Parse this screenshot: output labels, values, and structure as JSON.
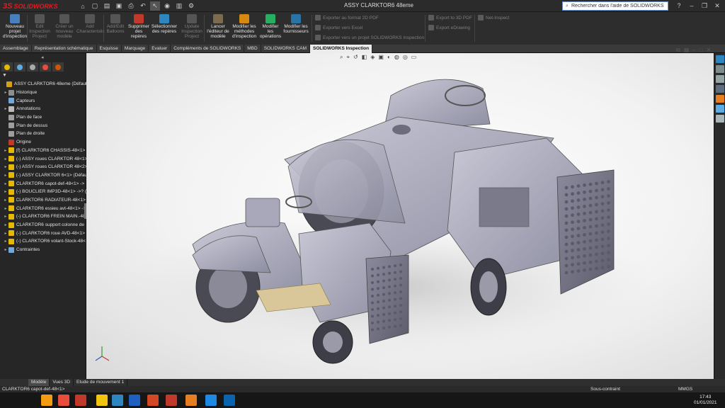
{
  "app": {
    "logo_text": "SOLIDWORKS",
    "logo_glyph": "3S"
  },
  "quick_access": {
    "icons": [
      "home-icon",
      "new-icon",
      "open-icon",
      "save-icon",
      "print-icon",
      "undo-icon",
      "select-icon",
      "rebuild-icon",
      "file-props-icon",
      "options-icon"
    ]
  },
  "title": "ASSY CLARKTOR6 48eme",
  "search": {
    "placeholder": "Rechercher dans l'aide de SOLIDWORKS"
  },
  "ribbon": {
    "buttons": [
      {
        "label": "Nouveau projet d'inspection",
        "enabled": true,
        "color": "#4a7fbf"
      },
      {
        "label": "Edit Inspection Project",
        "enabled": false,
        "color": "#555555"
      },
      {
        "label": "Créer un nouveau modèle",
        "enabled": false,
        "color": "#555555"
      },
      {
        "label": "Add Characteristic",
        "enabled": false,
        "color": "#555555"
      },
      {
        "label": "Add/Edit Balloons",
        "enabled": false,
        "color": "#555555"
      },
      {
        "label": "Supprimer des repères",
        "enabled": true,
        "color": "#c0392b"
      },
      {
        "label": "Sélectionner des repères",
        "enabled": true,
        "color": "#2e86c1"
      },
      {
        "label": "Update Inspection Project",
        "enabled": false,
        "color": "#555555"
      },
      {
        "label": "Lancer l'éditeur de modèle",
        "enabled": true,
        "color": "#7d6b4f"
      },
      {
        "label": "Modifier les méthodes d'inspection",
        "enabled": true,
        "color": "#d68910"
      },
      {
        "label": "Modifier les opérations",
        "enabled": true,
        "color": "#27ae60"
      },
      {
        "label": "Modifier les fournisseurs",
        "enabled": true,
        "color": "#2874a6"
      }
    ],
    "export_group_1": [
      "Exporter au format 2D PDF",
      "Exporter vers Excel",
      "Exporter vers un projet SOLIDWORKS Inspection"
    ],
    "export_group_2": [
      "Export to 3D PDF",
      "Export eDrawing"
    ],
    "export_group_3": [
      "Net-Inspect"
    ]
  },
  "tabs": [
    "Assemblage",
    "Représentation schématique",
    "Esquisse",
    "Marquage",
    "Evaluer",
    "Compléments de SOLIDWORKS",
    "MBD",
    "SOLIDWORKS CAM",
    "SOLIDWORKS Inspection"
  ],
  "active_tab": "SOLIDWORKS Inspection",
  "panel": {
    "tab_icons": [
      "feature-manager-icon",
      "property-manager-icon",
      "configuration-manager-icon",
      "dimxpert-icon",
      "display-manager-icon"
    ],
    "filter_icon": "filter-icon"
  },
  "tree": [
    {
      "label": "ASSY CLARKTOR6 48eme  (Défaut<Eta",
      "icon": "#d4a017",
      "expandable": false
    },
    {
      "label": "Historique",
      "icon": "#8e8e8e",
      "expandable": true
    },
    {
      "label": "Capteurs",
      "icon": "#6fa8dc",
      "expandable": false
    },
    {
      "label": "Annotations",
      "icon": "#bbbbbb",
      "expandable": true
    },
    {
      "label": "Plan de face",
      "icon": "#9e9e9e",
      "expandable": false
    },
    {
      "label": "Plan de dessus",
      "icon": "#9e9e9e",
      "expandable": false
    },
    {
      "label": "Plan de droite",
      "icon": "#9e9e9e",
      "expandable": false
    },
    {
      "label": "Origine",
      "icon": "#c0392b",
      "expandable": false
    },
    {
      "label": "(f) CLARKTOR6 CHASSIS-48<1> ->",
      "icon": "#e6b800",
      "expandable": true
    },
    {
      "label": "(-) ASSY roues CLARKTOR 48<1>",
      "icon": "#e6b800",
      "expandable": true
    },
    {
      "label": "(-) ASSY roues CLARKTOR 48<2>",
      "icon": "#e6b800",
      "expandable": true
    },
    {
      "label": "(-) ASSY CLARKTOR 6<1> (Défaut",
      "icon": "#e6b800",
      "expandable": true
    },
    {
      "label": "CLARKTOR6 capot-def-48<1> ->",
      "icon": "#e6b800",
      "expandable": true
    },
    {
      "label": "(-) BOUCLIER IMP3D-48<1> ->? (I",
      "icon": "#e6b800",
      "expandable": true
    },
    {
      "label": "CLARKTOR6 RADIATEUR-48<1> ->",
      "icon": "#e6b800",
      "expandable": true
    },
    {
      "label": "CLARKTOR6 essieu avt-48<1> ->",
      "icon": "#e6b800",
      "expandable": true
    },
    {
      "label": "(-) CLARKTOR6 FREIN MAIN.-48<",
      "icon": "#e6b800",
      "expandable": true
    },
    {
      "label": "CLARKTOR6 support colonne de",
      "icon": "#e6b800",
      "expandable": true
    },
    {
      "label": "(-) CLARKTOR6 roue AVD-48<1>",
      "icon": "#e6b800",
      "expandable": true
    },
    {
      "label": "(-) CLARKTOR6 volant-Stock-48<",
      "icon": "#e6b800",
      "expandable": true
    },
    {
      "label": "Contraintes",
      "icon": "#6fa8dc",
      "expandable": true
    }
  ],
  "hud_icons": [
    "zoom-fit-icon",
    "zoom-area-icon",
    "previous-view-icon",
    "section-view-icon",
    "view-orientation-icon",
    "display-style-icon",
    "hide-show-icon",
    "appearance-icon",
    "scene-icon",
    "display-settings-icon"
  ],
  "viewport_controls": [
    "restore-icon",
    "tile-icon",
    "minimize-icon",
    "maximize-icon",
    "close-icon"
  ],
  "task_pane_icons": [
    "resources-icon",
    "design-library-icon",
    "file-explorer-icon",
    "view-palette-icon",
    "appearances-icon",
    "custom-props-icon",
    "forum-icon"
  ],
  "bottom_tabs": [
    "Modèle",
    "Vues 3D",
    "Etude de mouvement 1"
  ],
  "status": {
    "selection": "CLARKTOR6 capot-def-48<1>",
    "state": "Sous-contraint",
    "units": "MMGS"
  },
  "taskbar": {
    "apps": [
      "start-icon",
      "search-icon",
      "task-view-icon",
      "vlc-icon",
      "app-icon",
      "solidworks-icon",
      "explorer-icon",
      "photos-icon",
      "word-icon",
      "powerpoint-icon",
      "acrobat-icon",
      "firefox-icon",
      "edge-icon",
      "outlook-icon"
    ],
    "time": "17:43",
    "date": "01/01/2021"
  },
  "colors": {
    "accent": "#e01b24",
    "active_tab": "#ececec",
    "model": "#9c9cb0"
  }
}
